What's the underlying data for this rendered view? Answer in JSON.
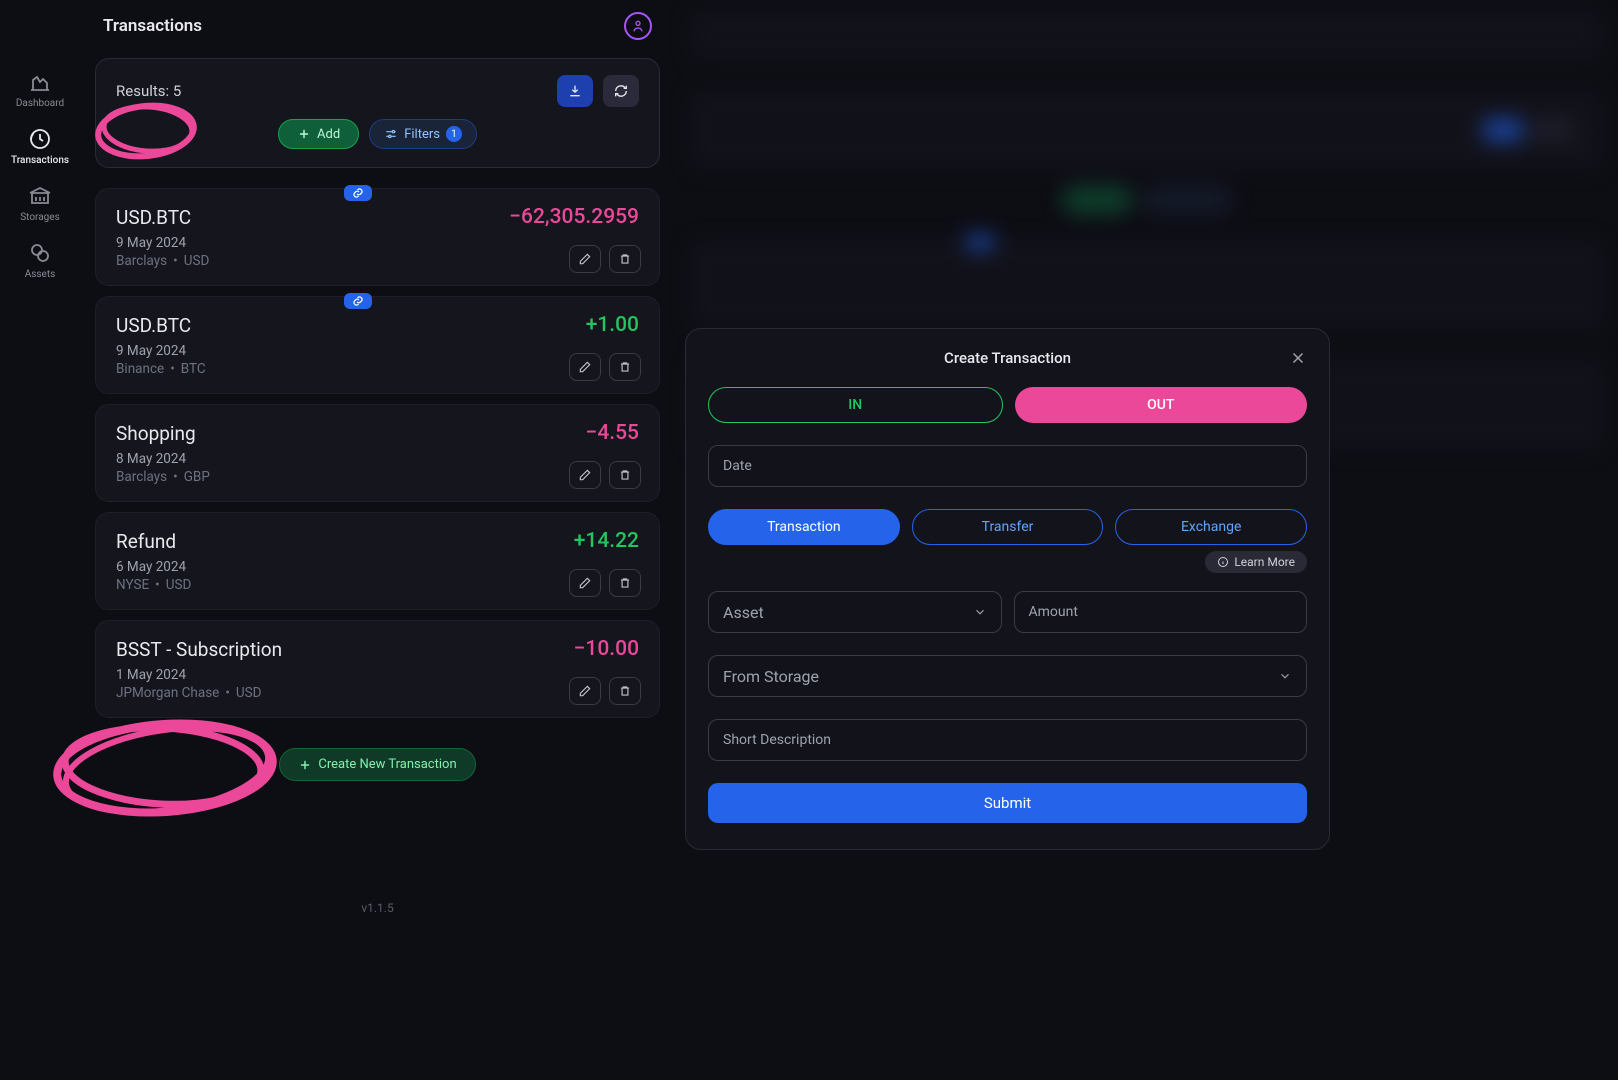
{
  "sidebar": {
    "items": [
      {
        "label": "Dashboard"
      },
      {
        "label": "Transactions"
      },
      {
        "label": "Storages"
      },
      {
        "label": "Assets"
      }
    ]
  },
  "pageTitle": "Transactions",
  "results": {
    "label": "Results: 5",
    "addLabel": "Add",
    "filtersLabel": "Filters",
    "filtersCount": "1"
  },
  "transactions": [
    {
      "name": "USD.BTC",
      "date": "9 May 2024",
      "storage": "Barclays",
      "asset": "USD",
      "amount": "−62,305.2959",
      "dir": "neg",
      "linked": true
    },
    {
      "name": "USD.BTC",
      "date": "9 May 2024",
      "storage": "Binance",
      "asset": "BTC",
      "amount": "+1.00",
      "dir": "pos",
      "linked": true
    },
    {
      "name": "Shopping",
      "date": "8 May 2024",
      "storage": "Barclays",
      "asset": "GBP",
      "amount": "−4.55",
      "dir": "neg",
      "linked": false
    },
    {
      "name": "Refund",
      "date": "6 May 2024",
      "storage": "NYSE",
      "asset": "USD",
      "amount": "+14.22",
      "dir": "pos",
      "linked": false
    },
    {
      "name": "BSST - Subscription",
      "date": "1 May 2024",
      "storage": "JPMorgan Chase",
      "asset": "USD",
      "amount": "−10.00",
      "dir": "neg",
      "linked": false
    }
  ],
  "createNewLabel": "Create New Transaction",
  "version": "v1.1.5",
  "modal": {
    "title": "Create Transaction",
    "inLabel": "IN",
    "outLabel": "OUT",
    "dateLabel": "Date",
    "typeTransaction": "Transaction",
    "typeTransfer": "Transfer",
    "typeExchange": "Exchange",
    "learnMore": "Learn More",
    "assetLabel": "Asset",
    "amountLabel": "Amount",
    "fromStorageLabel": "From Storage",
    "descLabel": "Short Description",
    "submitLabel": "Submit"
  }
}
